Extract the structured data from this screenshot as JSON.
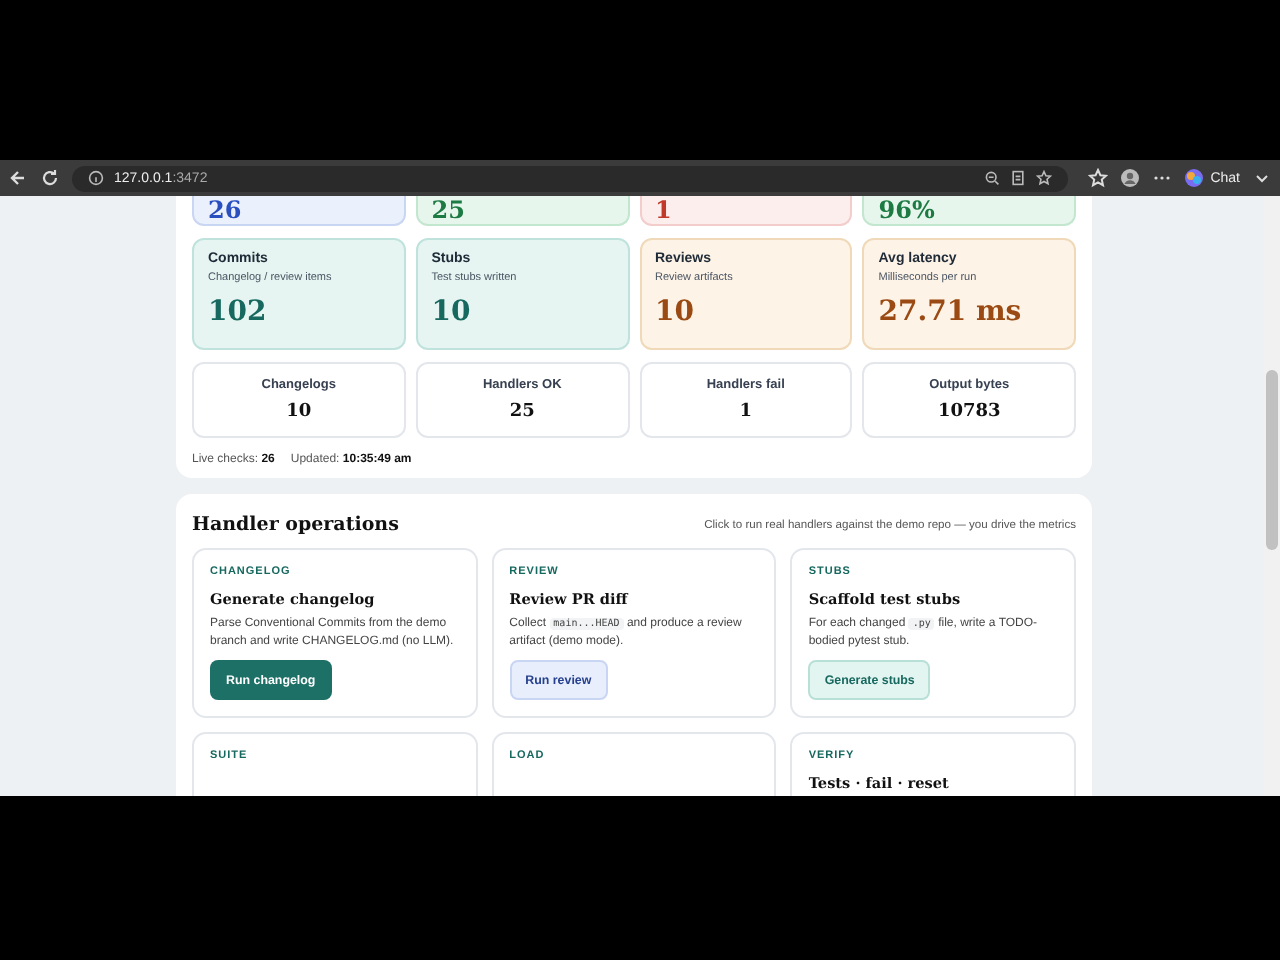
{
  "browser": {
    "url_host": "127.0.0.1",
    "url_port": ":3472",
    "copilot_label": "Chat"
  },
  "top_stats": [
    {
      "value": "26",
      "kind": "blue"
    },
    {
      "value": "25",
      "kind": "green"
    },
    {
      "value": "1",
      "kind": "red"
    },
    {
      "value": "96%",
      "kind": "green"
    }
  ],
  "metric_cards": [
    {
      "label": "Commits",
      "sub": "Changelog / review items",
      "value": "102",
      "kind": "teal"
    },
    {
      "label": "Stubs",
      "sub": "Test stubs written",
      "value": "10",
      "kind": "teal"
    },
    {
      "label": "Reviews",
      "sub": "Review artifacts",
      "value": "10",
      "kind": "amber"
    },
    {
      "label": "Avg latency",
      "sub": "Milliseconds per run",
      "value": "27.71 ms",
      "kind": "amber"
    }
  ],
  "counters": [
    {
      "label": "Changelogs",
      "value": "10"
    },
    {
      "label": "Handlers OK",
      "value": "25"
    },
    {
      "label": "Handlers fail",
      "value": "1"
    },
    {
      "label": "Output bytes",
      "value": "10783"
    }
  ],
  "status": {
    "checks_label": "Live checks:",
    "checks": "26",
    "updated_label": "Updated:",
    "updated": "10:35:49 am"
  },
  "operations": {
    "title": "Handler operations",
    "hint": "Click to run real handlers against the demo repo — you drive the metrics",
    "cards": [
      {
        "tag": "CHANGELOG",
        "title": "Generate changelog",
        "parts": [
          {
            "kind": "text",
            "text": "Parse Conventional Commits from the demo branch and write CHANGELOG.md (no LLM)."
          }
        ],
        "button": {
          "label": "Run changelog",
          "kind": "primary"
        }
      },
      {
        "tag": "REVIEW",
        "title": "Review PR diff",
        "parts": [
          {
            "kind": "text",
            "text": "Collect"
          },
          {
            "kind": "code",
            "text": "main...HEAD"
          },
          {
            "kind": "text",
            "text": "and produce a review artifact (demo mode)."
          }
        ],
        "button": {
          "label": "Run review",
          "kind": "blue"
        }
      },
      {
        "tag": "STUBS",
        "title": "Scaffold test stubs",
        "parts": [
          {
            "kind": "text",
            "text": "For each changed"
          },
          {
            "kind": "code",
            "text": ".py"
          },
          {
            "kind": "text",
            "text": "file, write a TODO-bodied pytest stub."
          }
        ],
        "button": {
          "label": "Generate stubs",
          "kind": "teal"
        }
      },
      {
        "tag": "SUITE"
      },
      {
        "tag": "LOAD"
      },
      {
        "tag": "VERIFY",
        "title": "Tests · fail · reset"
      }
    ]
  }
}
